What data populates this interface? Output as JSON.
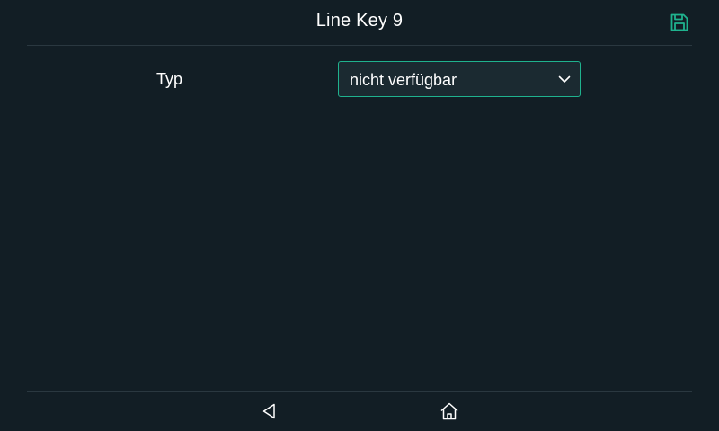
{
  "header": {
    "title": "Line Key 9",
    "save_icon": "save-icon",
    "accent_color": "#1fb28e"
  },
  "form": {
    "type_label": "Typ",
    "type_value": "nicht verfügbar"
  },
  "nav": {
    "back_icon": "back-triangle-icon",
    "home_icon": "home-icon"
  },
  "colors": {
    "background": "#121e25",
    "field_background": "#1b2a31",
    "field_border": "#1fb28e",
    "divider": "#2a3840",
    "text": "#ffffff"
  }
}
